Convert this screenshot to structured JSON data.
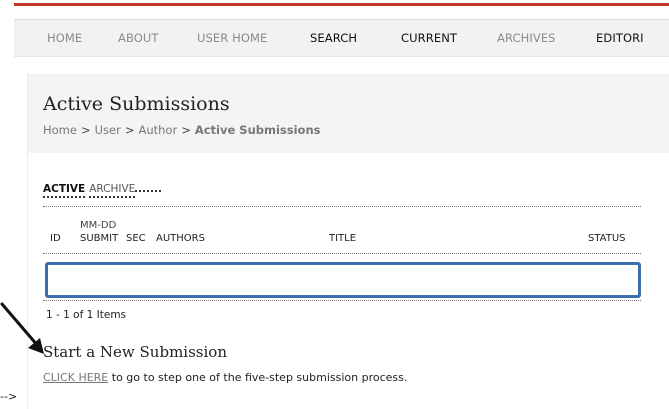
{
  "nav": {
    "items": [
      "HOME",
      "ABOUT",
      "USER HOME",
      "SEARCH",
      "CURRENT",
      "ARCHIVES",
      "EDITORI"
    ]
  },
  "page": {
    "title": "Active Submissions",
    "breadcrumb": [
      "Home",
      "User",
      "Author",
      "Active Submissions"
    ],
    "breadcrumb_sep": ">"
  },
  "subtabs": {
    "active": "ACTIVE",
    "archive": "ARCHIVE"
  },
  "table": {
    "columns": {
      "id": "ID",
      "mmdd": "MM-DD",
      "submit": "SUBMIT",
      "sec": "SEC",
      "authors": "AUTHORS",
      "title": "TITLE",
      "status": "STATUS"
    },
    "items_count": "1 - 1 of 1 Items"
  },
  "new_submission": {
    "title": "Start a New Submission",
    "link_text": "CLICK HERE",
    "after_link": " to go to step one of the five-step submission process."
  },
  "stray_text": "-->",
  "colors": {
    "accent_red": "#c0392b",
    "highlight_blue": "#3c6ea9"
  }
}
